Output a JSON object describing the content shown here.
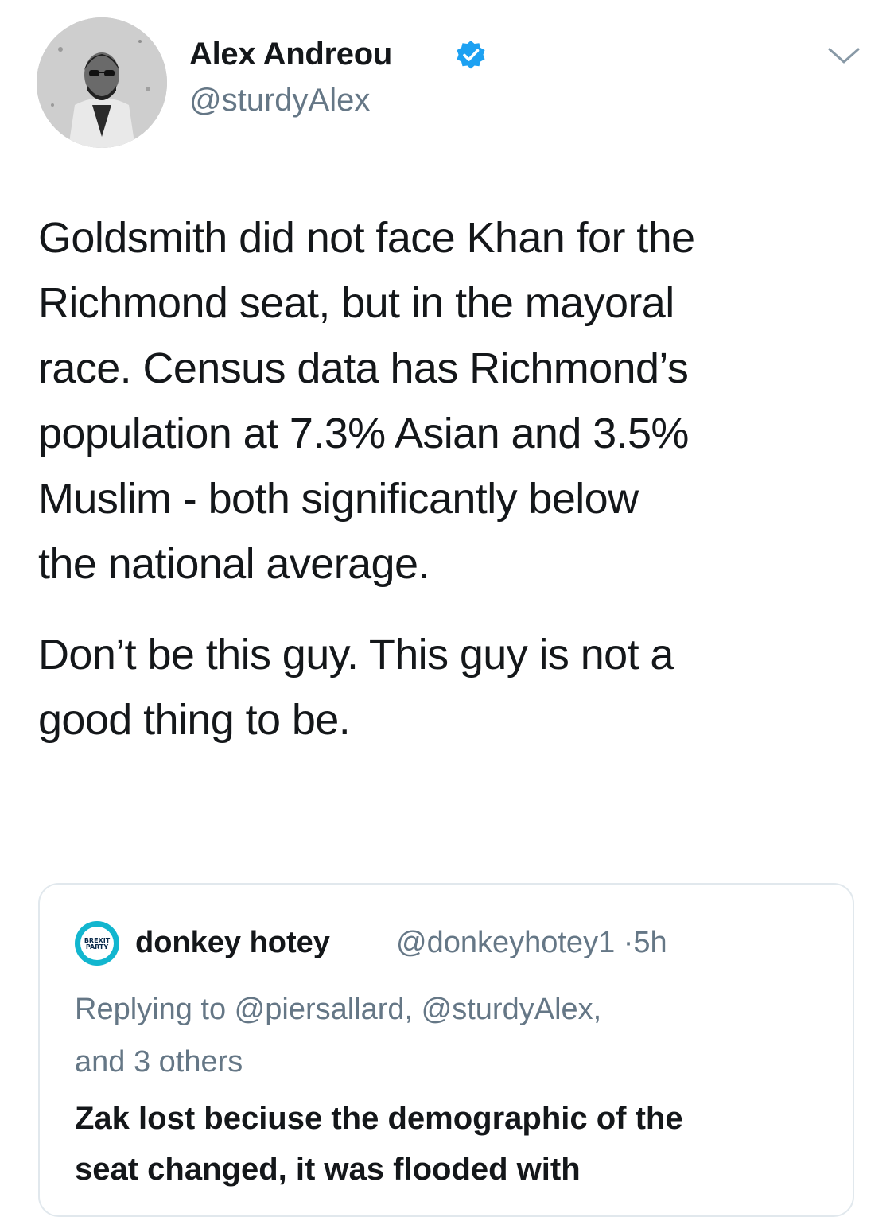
{
  "author": {
    "name": "Alex Andreou",
    "handle": "@sturdyAlex",
    "verified_color": "#1da1f2"
  },
  "tweet": {
    "lines_p1": [
      "Goldsmith did not face Khan for the",
      "Richmond seat, but in the mayoral",
      "race. Census data has Richmond’s",
      "population at 7.3% Asian and 3.5%",
      "Muslim - both significantly below",
      "the national average."
    ],
    "lines_p2": [
      "Don’t be this guy. This guy is not a",
      "good thing to be."
    ]
  },
  "quoted": {
    "avatar_text": "BREXIT PARTY",
    "name": "donkey hotey",
    "handle": "@donkeyhotey1",
    "separator": "·",
    "time": "5h",
    "reply_line1": "Replying to @piersallard, @sturdyAlex,",
    "reply_line2": "and 3 others",
    "text_lines": [
      "Zak lost beciuse the demographic of the",
      "seat changed, it was flooded with"
    ]
  },
  "icons": {
    "verified": "verified-badge-icon",
    "more": "chevron-down-icon"
  }
}
